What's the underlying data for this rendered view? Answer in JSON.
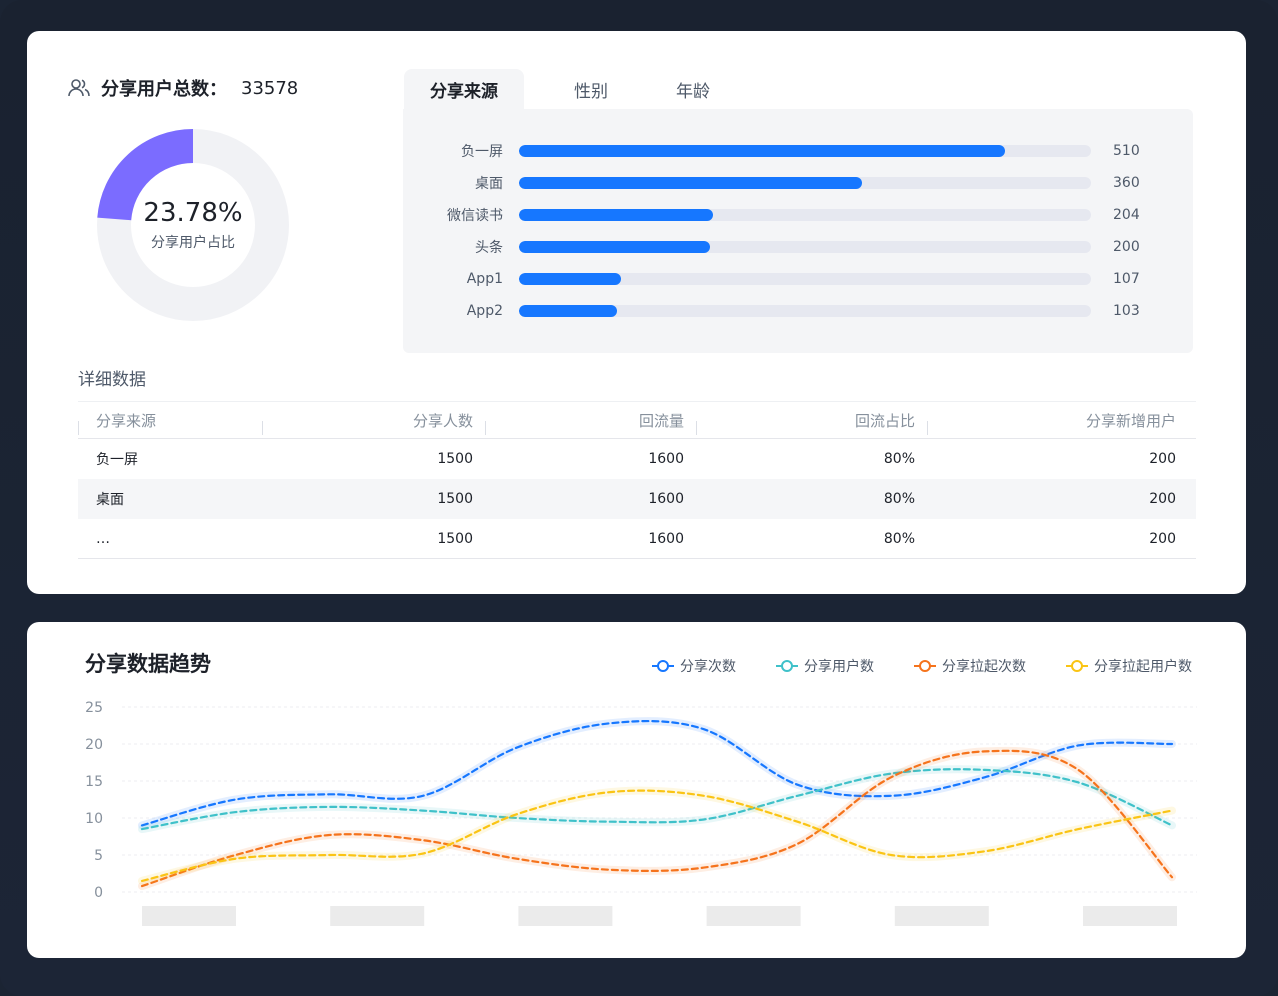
{
  "summary": {
    "total_label": "分享用户总数：",
    "total_value": "33578",
    "ratio_value": "23.78%",
    "ratio_fraction": 0.2378,
    "ratio_label": "分享用户占比",
    "ring_color": "#7b6cff"
  },
  "tabs": [
    {
      "label": "分享来源",
      "active": true
    },
    {
      "label": "性别",
      "active": false
    },
    {
      "label": "年龄",
      "active": false
    }
  ],
  "source_bars": {
    "max": 600,
    "color": "#1677ff",
    "items": [
      {
        "label": "负一屏",
        "value": 510
      },
      {
        "label": "桌面",
        "value": 360
      },
      {
        "label": "微信读书",
        "value": 204
      },
      {
        "label": "头条",
        "value": 200
      },
      {
        "label": "App1",
        "value": 107
      },
      {
        "label": "App2",
        "value": 103
      }
    ]
  },
  "detail": {
    "title": "详细数据",
    "columns": [
      "分享来源",
      "分享人数",
      "回流量",
      "回流占比",
      "分享新增用户"
    ],
    "rows": [
      [
        "负一屏",
        "1500",
        "1600",
        "80%",
        "200"
      ],
      [
        "桌面",
        "1500",
        "1600",
        "80%",
        "200"
      ],
      [
        "…",
        "1500",
        "1600",
        "80%",
        "200"
      ]
    ]
  },
  "trend": {
    "title": "分享数据趋势",
    "legend": [
      {
        "name": "分享次数",
        "color": "#1677ff"
      },
      {
        "name": "分享用户数",
        "color": "#3fc1c9"
      },
      {
        "name": "分享拉起次数",
        "color": "#f5731c"
      },
      {
        "name": "分享拉起用户数",
        "color": "#fac414"
      }
    ]
  },
  "chart_data": {
    "type": "line",
    "title": "分享数据趋势",
    "xlabel": "",
    "ylabel": "",
    "ylim": [
      0,
      25
    ],
    "yticks": [
      0,
      5,
      10,
      15,
      20,
      25
    ],
    "x": [
      0,
      1,
      2,
      3,
      4,
      5,
      6,
      7,
      8,
      9,
      10,
      11
    ],
    "x_tick_labels_hidden": 6,
    "grid": true,
    "legend_position": "top-right",
    "series": [
      {
        "name": "分享次数",
        "color": "#1677ff",
        "values": [
          9,
          12.5,
          13.2,
          13,
          19.5,
          22.8,
          22,
          14.5,
          13,
          15.5,
          19.8,
          20
        ]
      },
      {
        "name": "分享用户数",
        "color": "#3fc1c9",
        "values": [
          8.5,
          10.8,
          11.5,
          11,
          10,
          9.5,
          9.8,
          13,
          16,
          16.5,
          14.8,
          9
        ]
      },
      {
        "name": "分享拉起次数",
        "color": "#f5731c",
        "values": [
          0.8,
          5,
          7.7,
          7,
          4.5,
          3,
          3.3,
          6.5,
          15.5,
          19,
          16.5,
          2
        ]
      },
      {
        "name": "分享拉起用户数",
        "color": "#fac414",
        "values": [
          1.5,
          4.5,
          5,
          5.2,
          10.5,
          13.5,
          13,
          9.5,
          5,
          5.5,
          8.5,
          11
        ]
      }
    ]
  }
}
